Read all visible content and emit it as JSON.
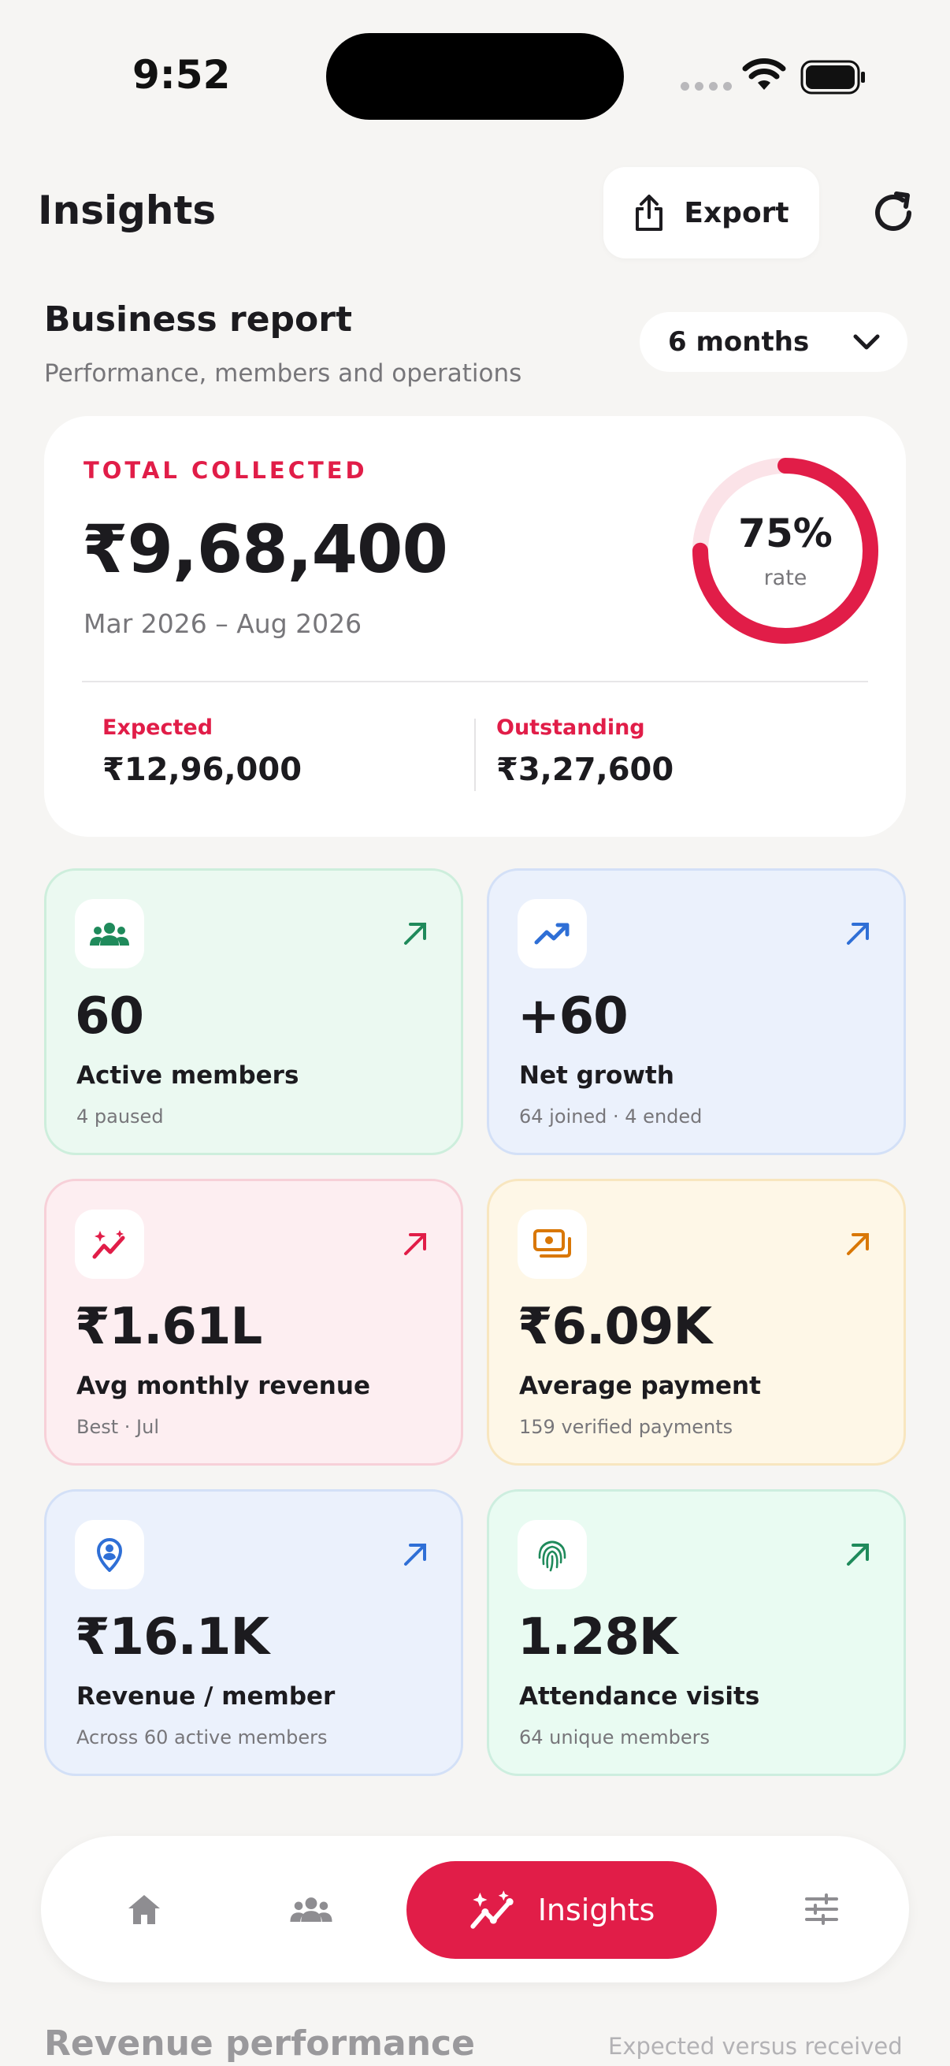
{
  "status_bar": {
    "time": "9:52"
  },
  "header": {
    "title": "Insights",
    "export_label": "Export"
  },
  "report": {
    "title": "Business report",
    "subtitle": "Performance, members and operations",
    "period": "6 months"
  },
  "total": {
    "label": "TOTAL COLLECTED",
    "amount": "₹9,68,400",
    "range": "Mar 2026 – Aug 2026",
    "rate_value": 0.75,
    "rate_text": "75%",
    "rate_label": "rate",
    "expected_label": "Expected",
    "expected_value": "₹12,96,000",
    "outstanding_label": "Outstanding",
    "outstanding_value": "₹3,27,600"
  },
  "stats": [
    {
      "value": "60",
      "label": "Active members",
      "sub": "4 paused",
      "icon": "members-icon",
      "color": "#1f8a5b"
    },
    {
      "value": "+60",
      "label": "Net growth",
      "sub": "64 joined · 4 ended",
      "icon": "trend-up-icon",
      "color": "#2f6fd6"
    },
    {
      "value": "₹1.61L",
      "label": "Avg monthly revenue",
      "sub": "Best · Jul",
      "icon": "sparkle-chart-icon",
      "color": "#e11d48"
    },
    {
      "value": "₹6.09K",
      "label": "Average payment",
      "sub": "159 verified payments",
      "icon": "cash-icon",
      "color": "#d97706"
    },
    {
      "value": "₹16.1K",
      "label": "Revenue / member",
      "sub": "Across 60 active members",
      "icon": "member-pin-icon",
      "color": "#2f6fd6"
    },
    {
      "value": "1.28K",
      "label": "Attendance visits",
      "sub": "64 unique members",
      "icon": "fingerprint-icon",
      "color": "#1f8a5b"
    }
  ],
  "nav": {
    "items": [
      "home-icon",
      "members-icon",
      "insights",
      "settings-sliders-icon"
    ],
    "active_label": "Insights"
  },
  "below": {
    "title": "Revenue performance",
    "subtitle": "Expected versus received"
  },
  "colors": {
    "accent": "#e11d48",
    "background": "#f6f5f3"
  }
}
